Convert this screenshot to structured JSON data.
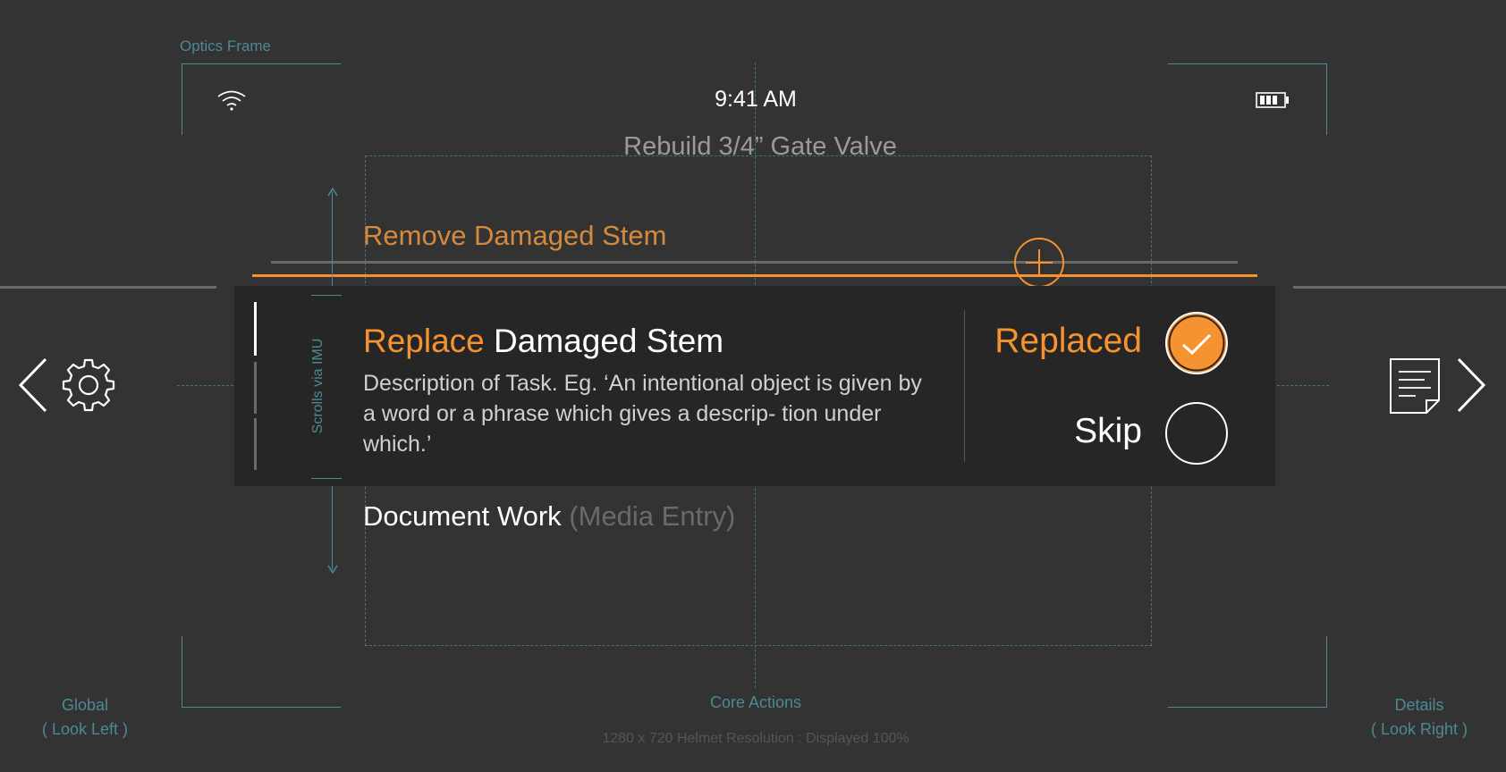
{
  "frame": {
    "optics_label": "Optics Frame",
    "scroll_label": "Scrolls via IMU",
    "global_label_line1": "Global",
    "global_label_line2": "( Look Left )",
    "core_label": "Core Actions",
    "details_label_line1": "Details",
    "details_label_line2": "( Look Right )",
    "resolution_note": "1280 x 720 Helmet Resolution : Displayed 100%"
  },
  "status": {
    "time": "9:41 AM",
    "wifi_icon": "wifi-icon",
    "battery_icon": "battery-icon"
  },
  "header": {
    "title": "Rebuild 3/4” Gate Valve"
  },
  "steps": {
    "previous": {
      "label": "Remove Damaged Stem"
    },
    "current": {
      "title_accent": "Replace",
      "title_rest": "Damaged Stem",
      "description": "Description of Task. Eg. ‘An intentional object is given by a word or a phrase which gives a descrip- tion under which.’"
    },
    "next": {
      "label": "Document Work",
      "hint": "(Media Entry)"
    }
  },
  "options": [
    {
      "label": "Replaced",
      "selected": true,
      "color": "#f6922f"
    },
    {
      "label": "Skip",
      "selected": false,
      "color": "#ffffff"
    }
  ],
  "nav": {
    "left_icons": [
      "chevron-left-icon",
      "gear-icon"
    ],
    "right_icons": [
      "document-icon",
      "chevron-right-icon"
    ]
  },
  "colors": {
    "accent": "#f6922f",
    "background": "#333333",
    "card": "#262626",
    "guide": "#4e8896"
  }
}
